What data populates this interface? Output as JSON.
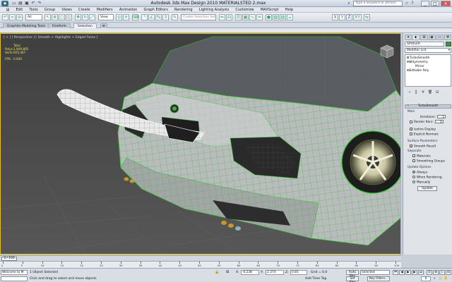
{
  "window": {
    "title": "Autodesk 3ds Max Design 2010     MATERIALSTED 2.max",
    "search_placeholder": "Type a keyword or phrase",
    "min": "_",
    "max": "□",
    "close": "✕"
  },
  "menu": [
    "Edit",
    "Tools",
    "Group",
    "Views",
    "Create",
    "Modifiers",
    "Animation",
    "Graph Editors",
    "Rendering",
    "Lighting Analysis",
    "Customize",
    "MAXScript",
    "Help"
  ],
  "toolbar": {
    "filter_value": "All",
    "view_value": "View",
    "selection_set_placeholder": "Create Selection Set"
  },
  "ribbon_tabs": [
    "Graphite Modeling Tools",
    "Freeform",
    "Selection"
  ],
  "viewport": {
    "label": "[ + ] [ Perspective ] [ Smooth + Highlights + Edged Faces ]",
    "stats": {
      "total_label": "Total",
      "polys_label": "Polys:",
      "polys_value": "1,949,805",
      "verts_label": "Verts:",
      "verts_value": "925,467",
      "fps_label": "FPS:",
      "fps_value": "0.640"
    },
    "colors": {
      "background": "#4a4a4a",
      "wire": "#2fbf2f",
      "body": "#b9bbbd",
      "selected_border": "#e8c000"
    }
  },
  "command_panel": {
    "object_name": "SPOILER",
    "modifier_list": "Modifier List",
    "stack": [
      {
        "name": "TurboSmooth",
        "level": 0
      },
      {
        "name": "Symmetry",
        "level": 0
      },
      {
        "name": "Mirror",
        "level": 1
      },
      {
        "name": "Editable Poly",
        "level": 0
      }
    ],
    "turbosmooth": {
      "title": "TurboSmooth",
      "main_label": "Main",
      "iterations_label": "Iterations:",
      "iterations_value": "1",
      "render_iters_label": "Render Iters:",
      "render_iters_value": "0",
      "isoline_label": "Isoline Display",
      "explicit_normals_label": "Explicit Normals",
      "surface_params_label": "Surface Parameters",
      "smooth_result_label": "Smooth Result",
      "separate_label": "Separate",
      "materials_label": "Materials",
      "smoothing_groups_label": "Smoothing Groups",
      "update_options_label": "Update Options",
      "always_label": "Always",
      "when_rendering_label": "When Rendering",
      "manually_label": "Manually",
      "update_button": "Update"
    }
  },
  "timeline": {
    "frame_display": "0 / 100",
    "ticks": [
      "0",
      "5",
      "10",
      "15",
      "20",
      "25",
      "30",
      "35",
      "40",
      "45",
      "50",
      "55",
      "60",
      "65",
      "70",
      "75",
      "80",
      "85",
      "90",
      "95",
      "100"
    ]
  },
  "status": {
    "maxscript_text": "Welcome to M",
    "selection_status": "1 Object Selected",
    "prompt": "Click and drag to select and move objects",
    "x_label": "X:",
    "x_value": "-0.238",
    "y_label": "Y:",
    "y_value": "2.374",
    "z_label": "Z:",
    "z_value": "0.83",
    "grid": "Grid = 0.0",
    "add_time_tag": "Add Time Tag",
    "auto_key": "Auto Key",
    "set_key": "Set Key",
    "key_mode": "Selected",
    "key_filters": "Key Filters...",
    "frame": "0"
  }
}
